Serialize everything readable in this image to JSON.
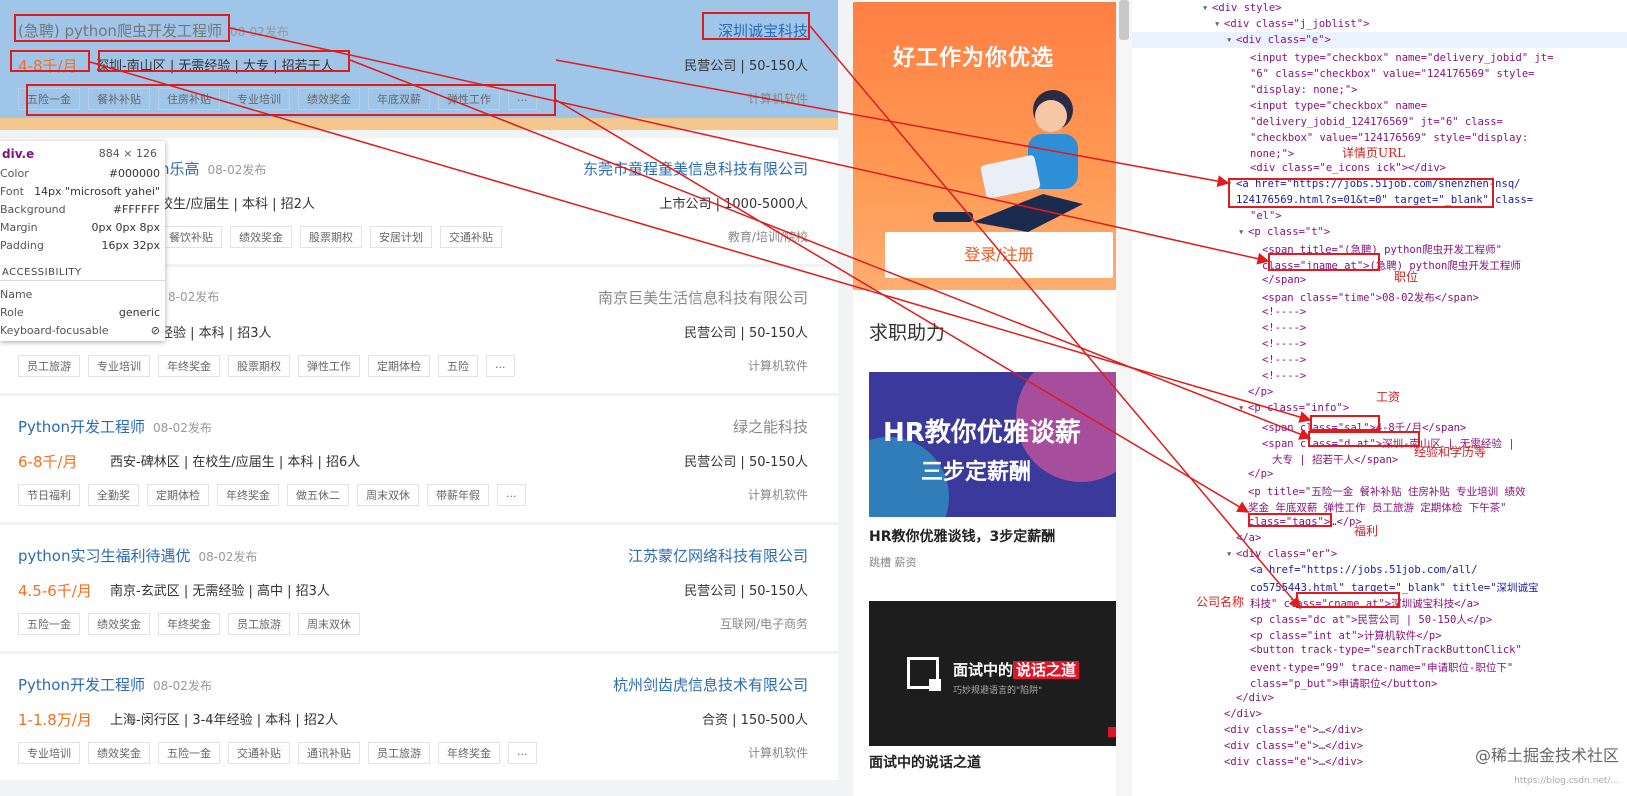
{
  "jobs": [
    {
      "title": "(急聘) python爬虫开发工程师",
      "time": "08-02发布",
      "company": "深圳诚宝科技",
      "salary": "4-8千/月",
      "detail": "深圳-南山区 | 无需经验 | 大专 | 招若干人",
      "dc": "民营公司 | 50-150人",
      "tags": [
        "五险一金",
        "餐补补贴",
        "住房补贴",
        "专业培训",
        "绩效奖金",
        "年底双薪",
        "弹性工作",
        "..."
      ],
      "industry": "计算机软件"
    },
    {
      "title": "n乐高",
      "time": "08-02发布",
      "company": "东莞市童程童美信息科技有限公司",
      "salary": "",
      "detail": "校生/应届生 | 本科 | 招2人",
      "dc": "上市公司 | 1000-5000人",
      "tags": [
        "餐饮补贴",
        "绩效奖金",
        "股票期权",
        "安居计划",
        "交通补贴"
      ],
      "industry": "教育/培训/院校"
    },
    {
      "title": "",
      "time": "8-02发布",
      "company": "南京巨美生活信息科技有限公司",
      "salary": "",
      "detail": "经验 | 本科 | 招3人",
      "dc": "民营公司 | 50-150人",
      "tags": [
        "员工旅游",
        "专业培训",
        "年终奖金",
        "股票期权",
        "弹性工作",
        "定期体检",
        "五险",
        "..."
      ],
      "industry": "计算机软件"
    },
    {
      "title": "Python开发工程师",
      "time": "08-02发布",
      "company": "绿之能科技",
      "salary": "6-8千/月",
      "detail": "西安-碑林区 | 在校生/应届生 | 本科 | 招6人",
      "dc": "民营公司 | 50-150人",
      "tags": [
        "节日福利",
        "全勤奖",
        "定期体检",
        "年终奖金",
        "做五休二",
        "周末双休",
        "带薪年假",
        "..."
      ],
      "industry": "计算机软件"
    },
    {
      "title": "python实习生福利待遇优",
      "time": "08-02发布",
      "company": "江苏蒙亿网络科技有限公司",
      "salary": "4.5-6千/月",
      "detail": "南京-玄武区 | 无需经验 | 高中 | 招3人",
      "dc": "民营公司 | 50-150人",
      "tags": [
        "五险一金",
        "绩效奖金",
        "年终奖金",
        "员工旅游",
        "周末双休"
      ],
      "industry": "互联网/电子商务"
    },
    {
      "title": "Python开发工程师",
      "time": "08-02发布",
      "company": "杭州剑齿虎信息技术有限公司",
      "salary": "1-1.8万/月",
      "detail": "上海-闵行区 | 3-4年经验 | 本科 | 招2人",
      "dc": "合资 | 150-500人",
      "tags": [
        "专业培训",
        "绩效奖金",
        "五险一金",
        "交通补贴",
        "通讯补贴",
        "员工旅游",
        "年终奖金",
        "..."
      ],
      "industry": "计算机软件"
    }
  ],
  "tooltip": {
    "selector": "div.e",
    "size": "884 × 126",
    "rows": [
      {
        "k": "Color",
        "v": "#000000"
      },
      {
        "k": "Font",
        "v": "14px \"microsoft yahei\""
      },
      {
        "k": "Background",
        "v": "#FFFFFF"
      },
      {
        "k": "Margin",
        "v": "0px 0px 8px"
      },
      {
        "k": "Padding",
        "v": "16px 32px"
      }
    ],
    "acc_title": "ACCESSIBILITY",
    "acc_rows": [
      {
        "k": "Name",
        "v": ""
      },
      {
        "k": "Role",
        "v": "generic"
      },
      {
        "k": "Keyboard-focusable",
        "v": ""
      }
    ]
  },
  "sidebar": {
    "banner1_title": "好工作为你优选",
    "login_button": "登录/注册",
    "assist_heading": "求职助力",
    "banner2_line1": "HR教你优雅谈薪",
    "banner2_line2": "三步定薪酬",
    "article1_title": "HR教你优雅谈钱，3步定薪酬",
    "article1_sub": "跳槽 薪资",
    "banner3_text_a": "面试中的",
    "banner3_text_b": "说话之道",
    "banner3_sub": "巧妙规避语言的\"陷阱\"",
    "article2_title": "面试中的说话之道"
  },
  "devtools": {
    "lines": [
      "<div style>",
      "<div class=\"j_joblist\">",
      "<div class=\"e\">",
      "<input type=\"checkbox\" name=\"delivery_jobid\" jt=",
      "\"6\" class=\"checkbox\" value=\"124176569\" style=",
      "\"display: none;\">",
      "<input type=\"checkbox\" name=",
      "\"delivery_jobid_124176569\" jt=\"6\" class=",
      "\"checkbox\" value=\"124176569\" style=\"display:",
      "none;\">",
      "<div class=\"e_icons ick\"></div>",
      "<a href=\"https://jobs.51job.com/shenzhen-nsq/",
      "124176569.html?s=01&t=0\" target=\"_blank\" class=",
      "\"el\">",
      "<p class=\"t\">",
      "<span title=\"(急聘) python爬虫开发工程师\"",
      "class=\"jname at\">(急聘) python爬虫开发工程师",
      "</span>",
      "<span class=\"time\">08-02发布</span>",
      "<!---->",
      "<!---->",
      "<!---->",
      "<!---->",
      "<!---->",
      "</p>",
      "<p class=\"info\">",
      "<span class=\"sal\">4-8千/月</span>",
      "<span class=\"d at\">深圳-南山区  |  无需经验  |",
      "大专  |  招若干人</span>",
      "</p>",
      "<p title=\"五险一金 餐补补贴 住房补贴 专业培训 绩效",
      "奖金 年底双薪 弹性工作 员工旅游 定期体检 下午茶\"",
      "class=\"tags\">…</p>",
      "</a>",
      "<div class=\"er\">",
      "<a href=\"https://jobs.51job.com/all/",
      "co5755443.html\" target=\"_blank\" title=\"深圳诚宝",
      "科技\" class=\"cname at\">深圳诚宝科技</a>",
      "<p class=\"dc at\">民营公司 | 50-150人</p>",
      "<p class=\"int at\">计算机软件</p>",
      "<button track-type=\"searchTrackButtonClick\"",
      "event-type=\"99\" trace-name=\"申请职位-职位下\"",
      "class=\"p_but\">申请职位</button>",
      "</div>",
      "</div>",
      "<div class=\"e\">…</div>",
      "<div class=\"e\">…</div>",
      "<div class=\"e\">…</div>"
    ],
    "notes": {
      "url": "详情页URL",
      "position": "职位",
      "salary": "工资",
      "exp": "经验和学历等",
      "welfare": "福利",
      "company": "公司名称"
    },
    "watermark": "@稀土掘金技术社区",
    "watermark2": "https://blog.csdn.net/..."
  }
}
